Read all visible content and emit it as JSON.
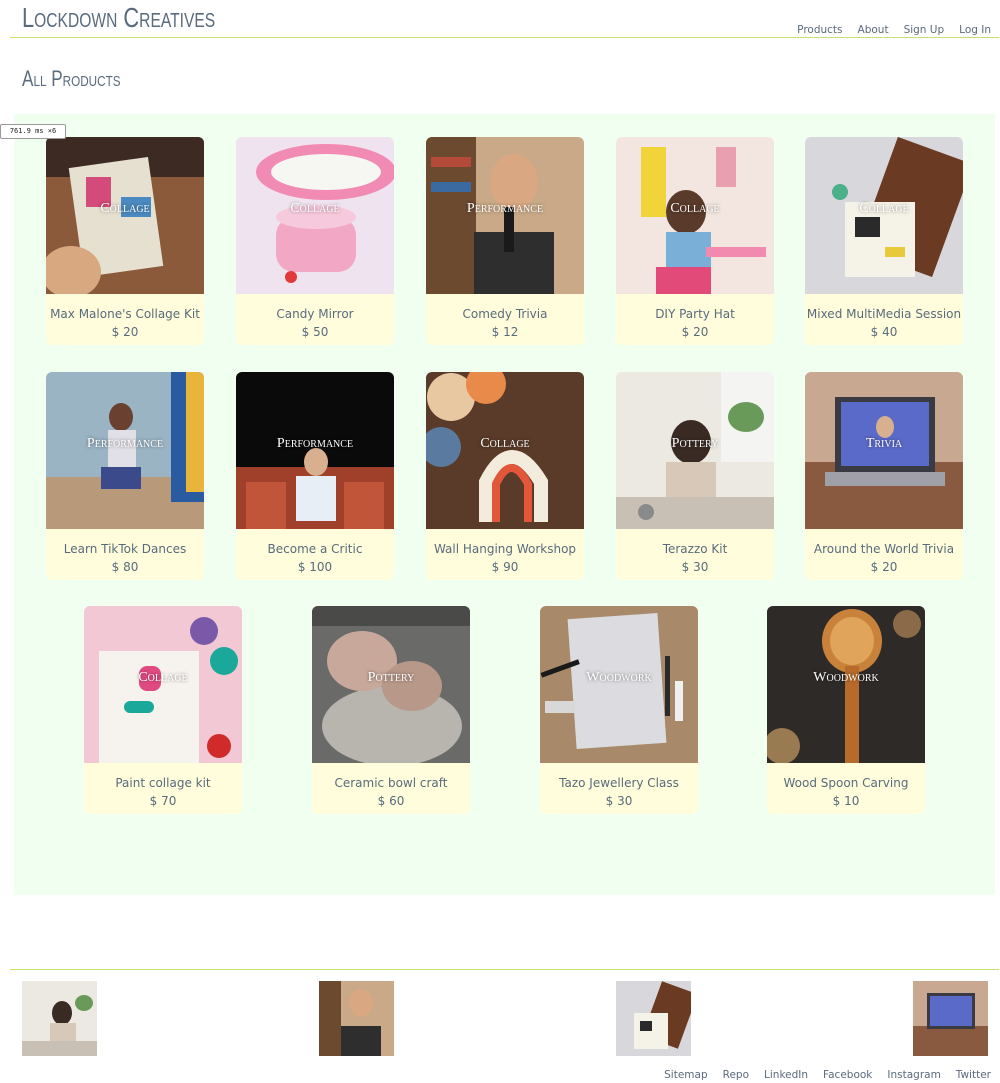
{
  "brand": "Lockdown Creatives",
  "nav": {
    "products": "Products",
    "about": "About",
    "signup": "Sign Up",
    "login": "Log In"
  },
  "page_title": "All Products",
  "timing_badge": "761.9 ms ×6",
  "products": [
    {
      "name": "Max Malone's Collage Kit",
      "price": "$ 20",
      "category": "Collage"
    },
    {
      "name": "Candy Mirror",
      "price": "$ 50",
      "category": "Collage"
    },
    {
      "name": "Comedy Trivia",
      "price": "$ 12",
      "category": "Performance"
    },
    {
      "name": "DIY Party Hat",
      "price": "$ 20",
      "category": "Collage"
    },
    {
      "name": "Mixed MultiMedia Session",
      "price": "$ 40",
      "category": "Collage"
    },
    {
      "name": "Learn TikTok Dances",
      "price": "$ 80",
      "category": "Performance"
    },
    {
      "name": "Become a Critic",
      "price": "$ 100",
      "category": "Performance"
    },
    {
      "name": "Wall Hanging Workshop",
      "price": "$ 90",
      "category": "Collage"
    },
    {
      "name": "Terazzo Kit",
      "price": "$ 30",
      "category": "Pottery"
    },
    {
      "name": "Around the World Trivia",
      "price": "$ 20",
      "category": "Trivia"
    },
    {
      "name": "Paint collage kit",
      "price": "$ 70",
      "category": "Collage"
    },
    {
      "name": "Ceramic bowl craft",
      "price": "$ 60",
      "category": "Pottery"
    },
    {
      "name": "Tazo Jewellery Class",
      "price": "$ 30",
      "category": "Woodwork"
    },
    {
      "name": "Wood Spoon Carving",
      "price": "$ 10",
      "category": "Woodwork"
    }
  ],
  "footer": {
    "links": [
      "Sitemap",
      "Repo",
      "LinkedIn",
      "Facebook",
      "Instagram",
      "Twitter"
    ]
  },
  "colors": {
    "accent_line": "#c6e26a",
    "grid_background": "#f1fff0",
    "card_caption_background": "#fffddb",
    "text": "#5a6b7c"
  }
}
